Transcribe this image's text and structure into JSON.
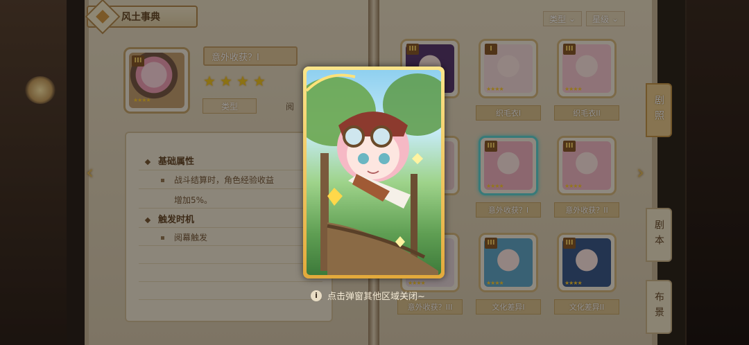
{
  "header": {
    "title": "风土事典"
  },
  "selected": {
    "name": "意外收获？I",
    "grade": "III",
    "stars": 4,
    "type_label": "类型",
    "tag_text": "阅"
  },
  "description": {
    "section1_title": "基础属性",
    "section1_body_line1": "战斗结算时，角色经验收益",
    "section1_body_line2": "增加5%。",
    "section2_title": "触发时机",
    "section2_body": "阅幕触发"
  },
  "filters": [
    {
      "label": "类型"
    },
    {
      "label": "星级"
    }
  ],
  "grid": [
    {
      "grade": "III",
      "label": "",
      "color": "#5a3a6e"
    },
    {
      "grade": "I",
      "label": "织毛衣I",
      "color": "#f4d9d9"
    },
    {
      "grade": "III",
      "label": "织毛衣II",
      "color": "#f6c7cf"
    },
    {
      "grade": "",
      "label": "",
      "color": "#e7c9c9"
    },
    {
      "grade": "III",
      "label": "意外收获？I",
      "color": "#f1b2bf"
    },
    {
      "grade": "III",
      "label": "意外收获？II",
      "color": "#f3b8c4"
    },
    {
      "grade": "",
      "label": "意外收获？III",
      "color": "#e6d5d8"
    },
    {
      "grade": "III",
      "label": "文化差异I",
      "color": "#63a8c8"
    },
    {
      "grade": "III",
      "label": "文化差异II",
      "color": "#3d5a8a"
    }
  ],
  "side_tabs": [
    {
      "label": "剧照",
      "active": true
    },
    {
      "label": "剧本",
      "active": false
    },
    {
      "label": "布景",
      "active": false
    }
  ],
  "hint": {
    "icon": "i",
    "text": "点击弹窗其他区域关闭~"
  },
  "stars_glyph": "★★★★",
  "star_glyph": "★",
  "arrow_left": "‹",
  "arrow_right": "›",
  "colors": {
    "accent": "#d6b77d",
    "selected": "#5fd2d0",
    "star": "#f2c421"
  }
}
